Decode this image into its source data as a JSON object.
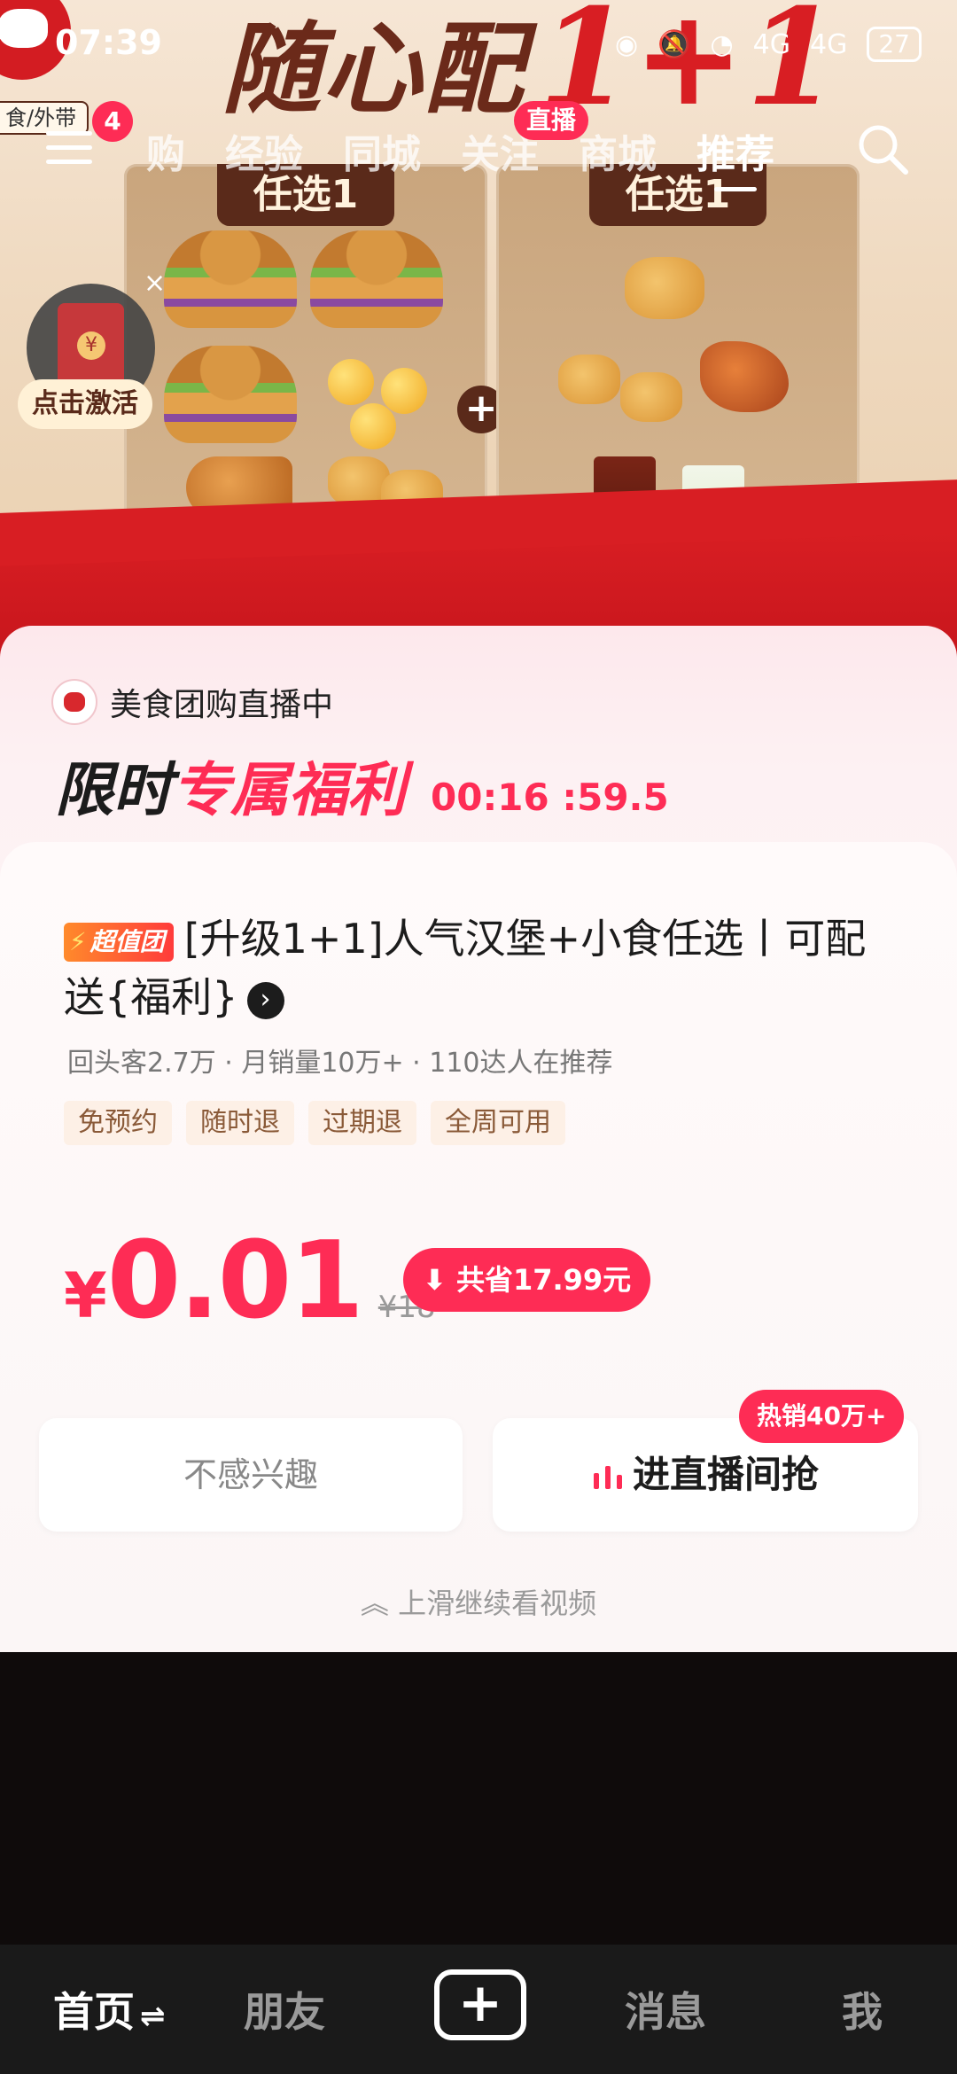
{
  "status_bar": {
    "time": "07:39",
    "network": "4G",
    "battery": "27"
  },
  "top_nav": {
    "food_tab": "食/外带",
    "notification_count": "4",
    "tabs": [
      "购",
      "经验",
      "同城",
      "关注",
      "商城",
      "推荐"
    ],
    "active_tab": "推荐",
    "live_badge": "直播"
  },
  "hero": {
    "title": "随心配",
    "title_number": "1+1",
    "panel_left_label": "任选1",
    "panel_right_label": "任选1"
  },
  "red_packet": {
    "close": "×",
    "label": "点击激活"
  },
  "card": {
    "live_name": "美食团购直播中",
    "promo_black": "限时",
    "promo_red": "专属福利",
    "countdown": "00:16 :59.5",
    "value_tag": "超值团",
    "title": "[升级1+1]人气汉堡+小食任选丨可配送{福利}",
    "stats": "回头客2.7万 · 月销量10万+ · 110达人在推荐",
    "tags": [
      "免预约",
      "随时退",
      "过期退",
      "全周可用"
    ],
    "currency": "¥",
    "price": "0.01",
    "original_price": "¥18",
    "savings": "共省17.99元",
    "hot_badge": "热销40万+",
    "not_interested": "不感兴趣",
    "go_live": "进直播间抢",
    "swipe_hint": "上滑继续看视频"
  },
  "bottom_nav": {
    "home": "首页",
    "friends": "朋友",
    "plus": "+",
    "messages": "消息",
    "me": "我"
  },
  "colors": {
    "accent": "#fe2c55",
    "brand_red": "#d81e23",
    "brand_brown": "#5a2a1a"
  }
}
